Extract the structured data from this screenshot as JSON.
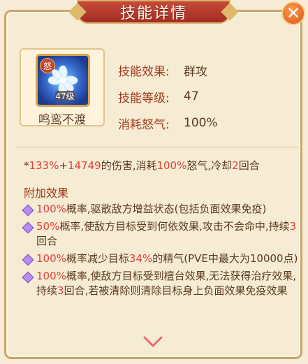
{
  "window": {
    "title": "技能详情",
    "close_label": "✕"
  },
  "skill": {
    "badge": "怒",
    "level_tag": "47级",
    "name": "鸣鸾不渡"
  },
  "stats": [
    {
      "label": "技能效果:",
      "value": "群攻"
    },
    {
      "label": "技能等级:",
      "value": "47"
    },
    {
      "label": "消耗怒气:",
      "value": "100%"
    }
  ],
  "summary": {
    "pre": "*",
    "pct": "133%",
    "plus": "+",
    "flat": "14749",
    "mid": "的伤害,消耗",
    "rage": "100%",
    "mid2": "怒气,冷却",
    "cd": "2",
    "post": "回合"
  },
  "extra": {
    "title": "附加效果",
    "effects": [
      {
        "pct": "100%",
        "text": "概率,驱散敌方增益状态(包括负面效果免疫)"
      },
      {
        "pct": "50%",
        "text_a": "概率,使敌方目标受到何依效果,攻击不会命中,持续",
        "num": "3",
        "text_b": "回合"
      },
      {
        "pct": "100%",
        "text_a": "概率减少目标",
        "num": "34%",
        "text_b": "的精气(PVE中最大为10000点)"
      },
      {
        "pct": "100%",
        "text_a": "概率,使敌方目标受到檀台效果,无法获得治疗效果,持续",
        "num": "3",
        "text_b": "回合,若被清除则清除目标身上负面效果免疫效果"
      }
    ]
  },
  "colors": {
    "accent": "#a2381e",
    "highlight": "#e0403a",
    "text": "#5a3a22"
  },
  "icons": {
    "close": "close-icon",
    "bullet": "diamond-gem-icon",
    "scroll": "chevron-down-icon"
  }
}
